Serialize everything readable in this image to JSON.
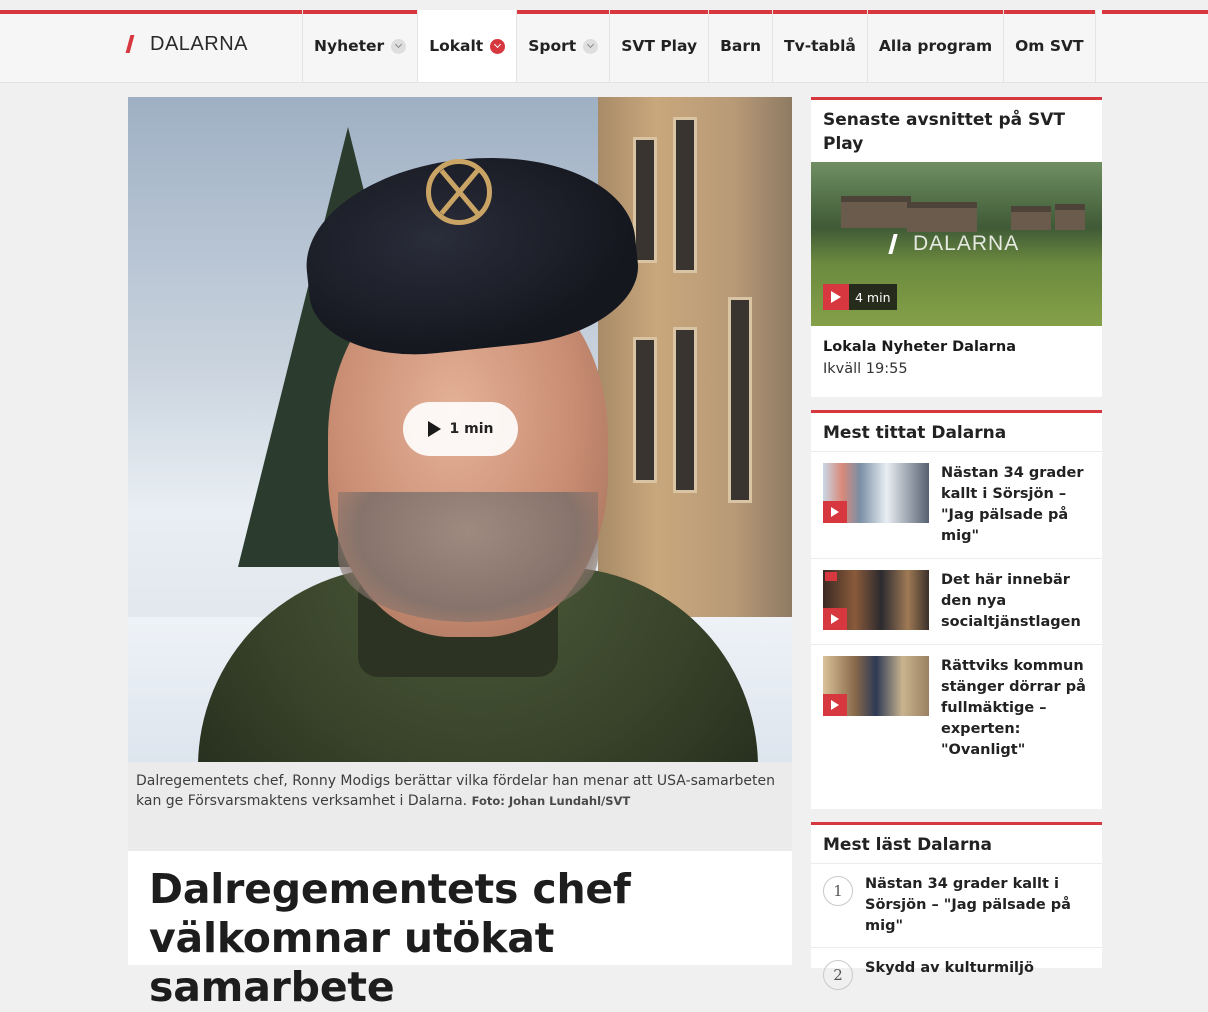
{
  "brand": {
    "name": "DALARNA"
  },
  "nav": {
    "items": [
      {
        "label": "Nyheter",
        "has_chevron": true,
        "active": false
      },
      {
        "label": "Lokalt",
        "has_chevron": true,
        "active": true
      },
      {
        "label": "Sport",
        "has_chevron": true,
        "active": false
      },
      {
        "label": "SVT Play",
        "has_chevron": false,
        "active": false
      },
      {
        "label": "Barn",
        "has_chevron": false,
        "active": false
      },
      {
        "label": "Tv-tablå",
        "has_chevron": false,
        "active": false
      },
      {
        "label": "Alla program",
        "has_chevron": false,
        "active": false
      },
      {
        "label": "Om SVT",
        "has_chevron": false,
        "active": false
      }
    ]
  },
  "hero": {
    "video_duration": "1 min",
    "caption": "Dalregementets chef, Ronny Modigs berättar vilka fördelar han menar att USA-samarbeten kan ge Försvarsmaktens verksamhet i Dalarna.",
    "credit": "Foto: Johan Lundahl/SVT"
  },
  "article": {
    "headline": "Dalregementets chef välkomnar utökat samarbete"
  },
  "sidebar": {
    "latest_episode": {
      "heading": "Senaste avsnittet på SVT Play",
      "thumb_logo": "DALARNA",
      "duration": "4 min",
      "title": "Lokala Nyheter Dalarna",
      "time": "Ikväll 19:55"
    },
    "most_watched": {
      "heading": "Mest tittat Dalarna",
      "items": [
        {
          "title": "Nästan 34 grader kallt i Sörsjön – \"Jag pälsade på mig\""
        },
        {
          "title": "Det här innebär den nya socialtjänstlagen"
        },
        {
          "title": "Rättviks kommun stänger dörrar på fullmäktige – experten: \"Ovanligt\""
        }
      ]
    },
    "most_read": {
      "heading": "Mest läst Dalarna",
      "items": [
        {
          "rank": "1",
          "title": "Nästan 34 grader kallt i Sörsjön – \"Jag pälsade på mig\""
        },
        {
          "rank": "2",
          "title": "Skydd av kulturmiljö"
        }
      ]
    }
  },
  "colors": {
    "accent": "#d7373f",
    "background": "#f0f0f0"
  }
}
